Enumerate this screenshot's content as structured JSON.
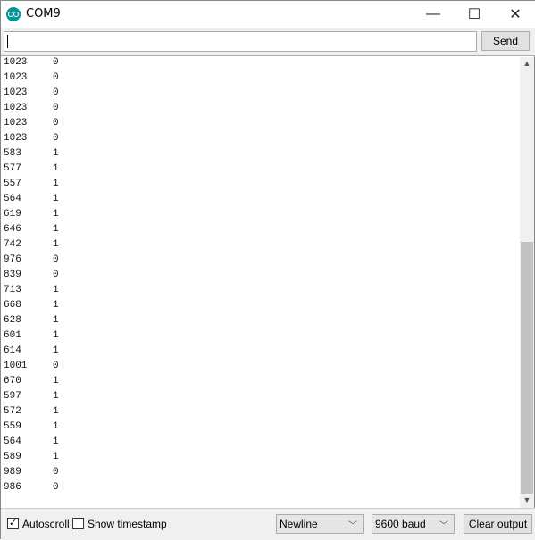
{
  "window": {
    "title": "COM9",
    "minimize": "—",
    "maximize": "☐",
    "close": "✕"
  },
  "input": {
    "value": "",
    "send_label": "Send"
  },
  "output": {
    "lines": [
      [
        "1023",
        "0"
      ],
      [
        "1023",
        "0"
      ],
      [
        "1023",
        "0"
      ],
      [
        "1023",
        "0"
      ],
      [
        "1023",
        "0"
      ],
      [
        "1023",
        "0"
      ],
      [
        "583",
        "1"
      ],
      [
        "577",
        "1"
      ],
      [
        "557",
        "1"
      ],
      [
        "564",
        "1"
      ],
      [
        "619",
        "1"
      ],
      [
        "646",
        "1"
      ],
      [
        "742",
        "1"
      ],
      [
        "976",
        "0"
      ],
      [
        "839",
        "0"
      ],
      [
        "713",
        "1"
      ],
      [
        "668",
        "1"
      ],
      [
        "628",
        "1"
      ],
      [
        "601",
        "1"
      ],
      [
        "614",
        "1"
      ],
      [
        "1001",
        "0"
      ],
      [
        "670",
        "1"
      ],
      [
        "597",
        "1"
      ],
      [
        "572",
        "1"
      ],
      [
        "559",
        "1"
      ],
      [
        "564",
        "1"
      ],
      [
        "589",
        "1"
      ],
      [
        "989",
        "0"
      ],
      [
        "986",
        "0"
      ]
    ]
  },
  "footer": {
    "autoscroll_label": "Autoscroll",
    "autoscroll_checked": true,
    "timestamp_label": "Show timestamp",
    "timestamp_checked": false,
    "line_ending": "Newline",
    "baud": "9600 baud",
    "clear_label": "Clear output"
  }
}
